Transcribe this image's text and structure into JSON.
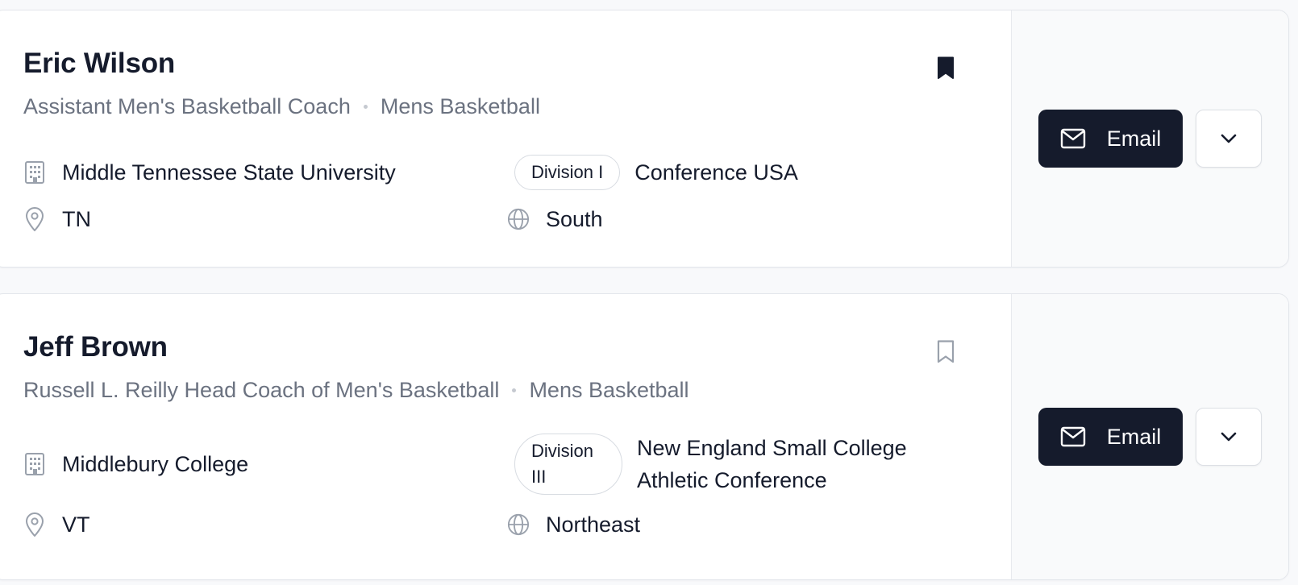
{
  "results": [
    {
      "name": "Eric Wilson",
      "title": "Assistant Men's Basketball Coach",
      "sport": "Mens Basketball",
      "bookmarked": true,
      "school": "Middle Tennessee State University",
      "division": "Division I",
      "conference": "Conference USA",
      "state": "TN",
      "region": "South",
      "email_label": "Email"
    },
    {
      "name": "Jeff Brown",
      "title": "Russell L. Reilly Head Coach of Men's Basketball",
      "sport": "Mens Basketball",
      "bookmarked": false,
      "school": "Middlebury College",
      "division": "Division III",
      "conference": "New England Small College Athletic Conference",
      "state": "VT",
      "region": "Northeast",
      "email_label": "Email"
    }
  ],
  "icons": {
    "school": "building-icon",
    "location": "map-pin-icon",
    "region": "globe-icon",
    "email": "mail-icon",
    "dropdown": "chevron-down-icon",
    "bookmark": "bookmark-icon"
  },
  "colors": {
    "primary_button": "#151b2c",
    "text": "#151b2c",
    "muted_text": "#6b7280",
    "border": "#e3e6eb",
    "side_panel": "#f9fafb"
  }
}
